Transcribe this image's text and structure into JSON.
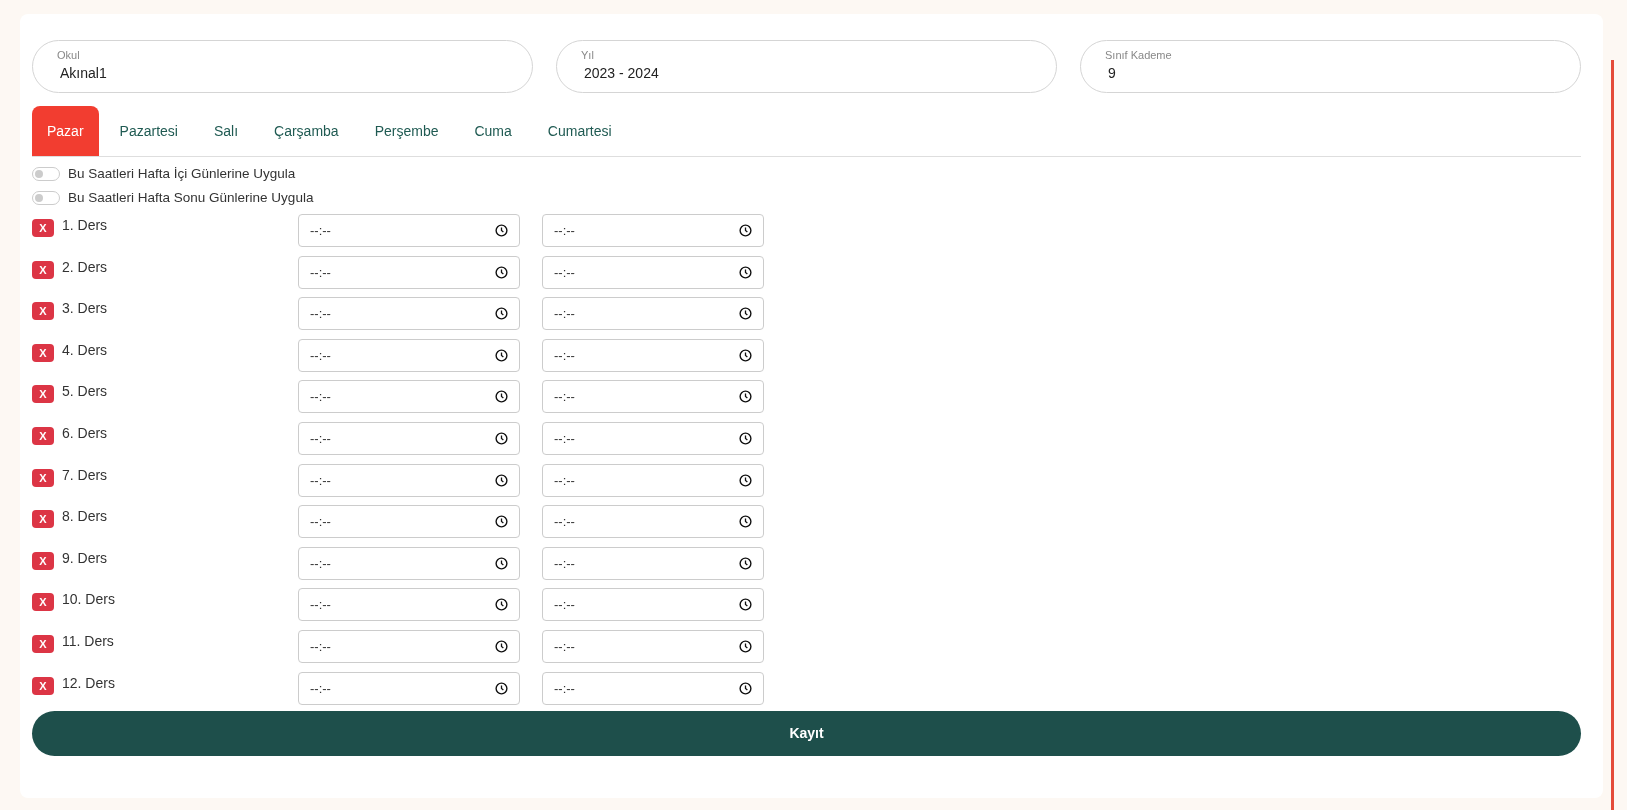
{
  "filters": [
    {
      "label": "Okul",
      "value": "Akınal1"
    },
    {
      "label": "Yıl",
      "value": "2023 - 2024"
    },
    {
      "label": "Sınıf Kademe",
      "value": "9"
    }
  ],
  "tabs": [
    {
      "label": "Pazar",
      "selected": true
    },
    {
      "label": "Pazartesi",
      "selected": false
    },
    {
      "label": "Salı",
      "selected": false
    },
    {
      "label": "Çarşamba",
      "selected": false
    },
    {
      "label": "Perşembe",
      "selected": false
    },
    {
      "label": "Cuma",
      "selected": false
    },
    {
      "label": "Cumartesi",
      "selected": false
    }
  ],
  "toggles": [
    {
      "label": "Bu Saatleri Hafta İçi Günlerine Uygula",
      "on": false
    },
    {
      "label": "Bu Saatleri Hafta Sonu Günlerine Uygula",
      "on": false
    }
  ],
  "lessons": [
    {
      "remove": "X",
      "label": "1. Ders",
      "start": "--:--",
      "end": "--:--"
    },
    {
      "remove": "X",
      "label": "2. Ders",
      "start": "--:--",
      "end": "--:--"
    },
    {
      "remove": "X",
      "label": "3. Ders",
      "start": "--:--",
      "end": "--:--"
    },
    {
      "remove": "X",
      "label": "4. Ders",
      "start": "--:--",
      "end": "--:--"
    },
    {
      "remove": "X",
      "label": "5. Ders",
      "start": "--:--",
      "end": "--:--"
    },
    {
      "remove": "X",
      "label": "6. Ders",
      "start": "--:--",
      "end": "--:--"
    },
    {
      "remove": "X",
      "label": "7. Ders",
      "start": "--:--",
      "end": "--:--"
    },
    {
      "remove": "X",
      "label": "8. Ders",
      "start": "--:--",
      "end": "--:--"
    },
    {
      "remove": "X",
      "label": "9. Ders",
      "start": "--:--",
      "end": "--:--"
    },
    {
      "remove": "X",
      "label": "10. Ders",
      "start": "--:--",
      "end": "--:--"
    },
    {
      "remove": "X",
      "label": "11. Ders",
      "start": "--:--",
      "end": "--:--"
    },
    {
      "remove": "X",
      "label": "12. Ders",
      "start": "--:--",
      "end": "--:--"
    }
  ],
  "save_button": "Kayıt"
}
